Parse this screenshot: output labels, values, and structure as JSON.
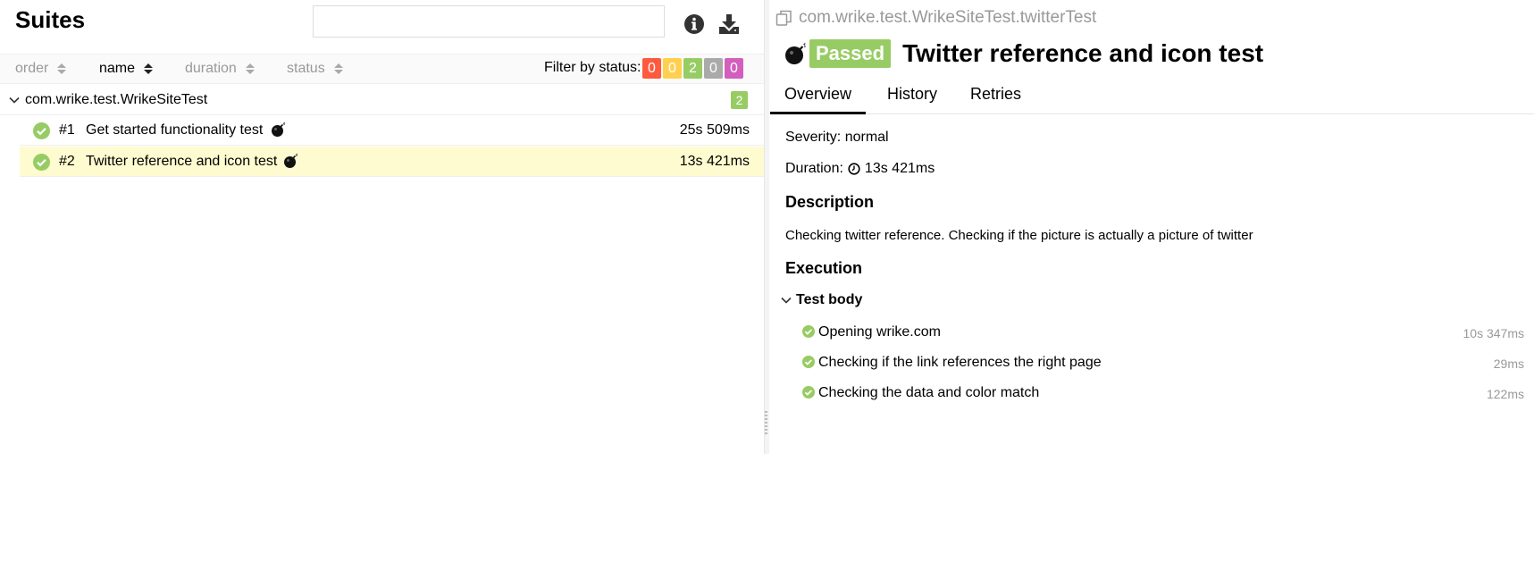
{
  "colors": {
    "failed": "#fd5a3e",
    "broken": "#ffd050",
    "passed": "#97cc64",
    "skipped": "#aaaaaa",
    "unknown": "#d35ebe",
    "selected_row": "#fffbd0"
  },
  "left": {
    "title": "Suites",
    "search_placeholder": "",
    "icons": [
      "info-icon",
      "download-icon"
    ],
    "sort": [
      "order",
      "name",
      "duration",
      "status"
    ],
    "active_sort": "name",
    "filter_label": "Filter by status:",
    "status_counts": [
      "0",
      "0",
      "2",
      "0",
      "0"
    ],
    "group": {
      "name": "com.wrike.test.WrikeSiteTest",
      "count": "2"
    },
    "tests": [
      {
        "num": "#1",
        "name": "Get started functionality test",
        "duration": "25s 509ms",
        "icon": "bomb-icon"
      },
      {
        "num": "#2",
        "name": "Twitter reference and icon test",
        "duration": "13s 421ms",
        "icon": "bomb-icon",
        "selected": true
      }
    ]
  },
  "right": {
    "full_name": "com.wrike.test.WrikeSiteTest.twitterTest",
    "status": "Passed",
    "title": "Twitter reference and icon test",
    "tabs": [
      "Overview",
      "History",
      "Retries"
    ],
    "severity": "Severity: normal",
    "duration_label": "Duration:",
    "duration_value": "13s 421ms",
    "description_h": "Description",
    "description": "Checking twitter reference. Checking if the picture is actually a picture of twitter",
    "execution_h": "Execution",
    "test_body": "Test body",
    "steps": [
      {
        "name": "Opening wrike.com",
        "duration": "10s 347ms"
      },
      {
        "name": "Checking if the link references the right page",
        "duration": "29ms"
      },
      {
        "name": "Checking the data and color match",
        "duration": "122ms"
      }
    ]
  }
}
